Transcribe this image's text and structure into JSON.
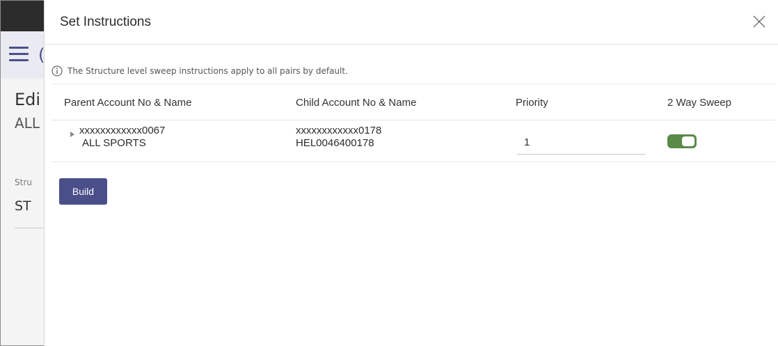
{
  "background": {
    "title_partial": "Edi",
    "subtitle_partial": "ALL",
    "label_partial": "Stru",
    "value_partial": "ST"
  },
  "modal": {
    "title": "Set Instructions",
    "info_text": "The Structure level sweep instructions apply to all pairs by default.",
    "columns": {
      "parent": "Parent Account No & Name",
      "child": "Child Account No & Name",
      "priority": "Priority",
      "two_way": "2 Way Sweep"
    },
    "row": {
      "parent_account": "xxxxxxxxxxxx0067",
      "parent_name": "ALL SPORTS",
      "child_account": "xxxxxxxxxxxx0178",
      "child_name": "HEL0046400178",
      "priority": "1",
      "two_way_enabled": true
    },
    "build_label": "Build"
  },
  "colors": {
    "primary": "#4a4f8a",
    "toggle_on": "#5b8a48"
  }
}
